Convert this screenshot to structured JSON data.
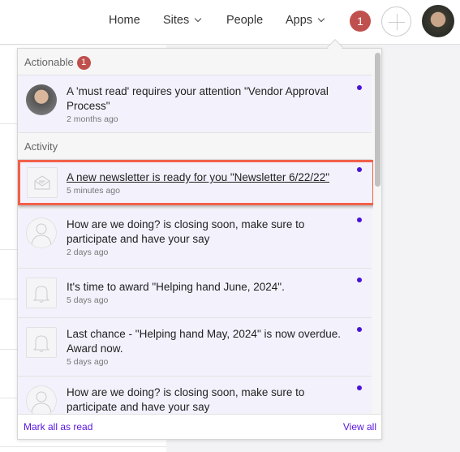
{
  "nav": {
    "home": "Home",
    "sites": "Sites",
    "people": "People",
    "apps": "Apps",
    "notification_count": "1"
  },
  "dropdown": {
    "actionable": {
      "label": "Actionable",
      "count": "1",
      "items": [
        {
          "text": "A 'must read' requires your attention \"Vendor Approval Process\"",
          "time": "2 months ago",
          "icon": "user-avatar",
          "unread": true
        }
      ]
    },
    "activity": {
      "label": "Activity",
      "items": [
        {
          "text": "A new newsletter is ready for you \"Newsletter 6/22/22\"",
          "time": "5 minutes ago",
          "icon": "envelope-icon",
          "unread": true,
          "highlighted": true
        },
        {
          "text": "How are we doing? is closing soon, make sure to participate and have your say",
          "time": "2 days ago",
          "icon": "person-icon",
          "unread": true
        },
        {
          "text": "It's time to award \"Helping hand June, 2024\".",
          "time": "5 days ago",
          "icon": "bell-icon",
          "unread": true
        },
        {
          "text": "Last chance - \"Helping hand May, 2024\" is now overdue. Award now.",
          "time": "5 days ago",
          "icon": "bell-icon",
          "unread": true
        },
        {
          "text": "How are we doing? is closing soon, make sure to participate and have your say",
          "time": "",
          "icon": "person-icon",
          "unread": true
        }
      ]
    },
    "footer": {
      "mark_all": "Mark all as read",
      "view_all": "View all"
    },
    "colors": {
      "unread_dot": "#4a12d9",
      "badge": "#c0504d",
      "highlight": "#f2604a",
      "link": "#5a18e0"
    }
  }
}
